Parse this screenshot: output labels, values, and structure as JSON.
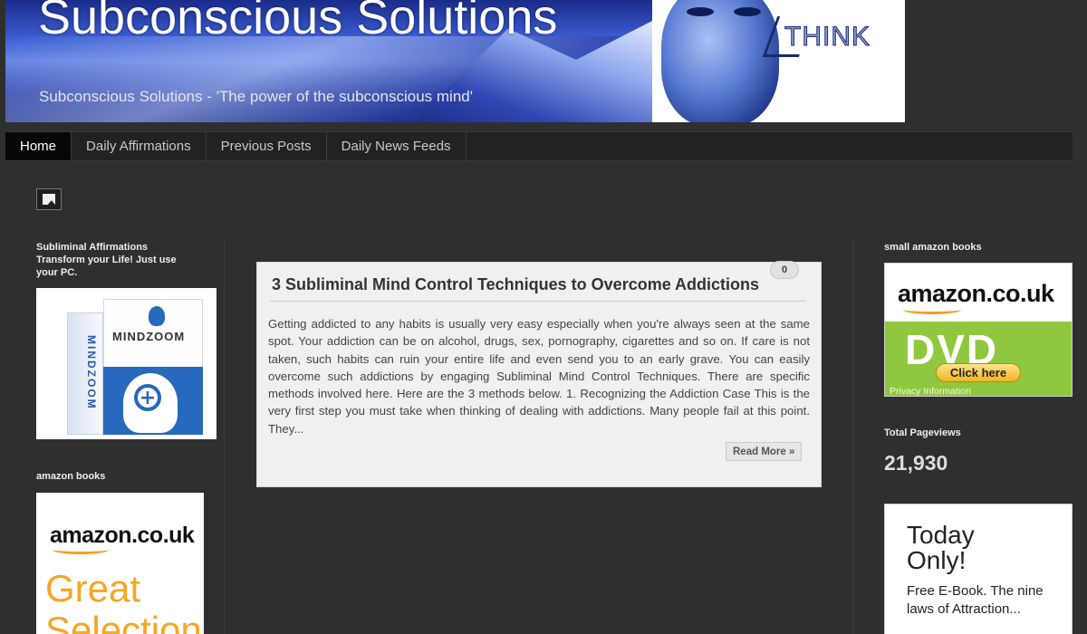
{
  "header": {
    "title": "Subconscious Solutions",
    "tagline": "Subconscious Solutions - 'The power of the subconscious mind'",
    "banner_word": "THINK"
  },
  "nav": {
    "items": [
      {
        "label": "Home",
        "active": true
      },
      {
        "label": "Daily Affirmations",
        "active": false
      },
      {
        "label": "Previous Posts",
        "active": false
      },
      {
        "label": "Daily News Feeds",
        "active": false
      }
    ]
  },
  "left_sidebar": {
    "widget1": {
      "title": "Subliminal Affirmations",
      "subtitle": "Transform your Life! Just use your PC.",
      "product": "MINDZOOM",
      "product_vertical": "MINDZOOM"
    },
    "widget2": {
      "title": "amazon books",
      "logo": "amazon.co.uk",
      "line1": "Great",
      "line2": "Selection"
    }
  },
  "post": {
    "title": "3 Subliminal Mind Control Techniques to Overcome Addictions",
    "comment_count": "0",
    "excerpt": "Getting addicted to any habits is usually very easy especially when you're always seen at the same spot. Your addiction can be on alcohol, drugs, sex, pornography, cigarettes and so on. If care is not taken, such habits can ruin your entire life and even send you to an early grave. You can easily overcome such addictions by engaging Subliminal Mind Control Techniques. There are specific methods involved here. Here are the 3 methods below. 1. Recognizing the Addiction Case This is the very first step you must take when thinking of dealing with addictions. Many people fail at this point. They...",
    "read_more": "Read More »"
  },
  "right_sidebar": {
    "widget1": {
      "title": "small amazon books",
      "logo": "amazon.co.uk",
      "dvd": "DVD",
      "button": "Click here",
      "privacy": "Privacy Information"
    },
    "pageviews": {
      "label": "Total Pageviews",
      "count": "21,930"
    },
    "promo": {
      "headline_1": "Today",
      "headline_2": "Only!",
      "text": "Free E-Book. The nine laws of Attraction..."
    }
  },
  "colors": {
    "page_bg": "#2f2f2f",
    "nav_bg": "#222222",
    "nav_active_bg": "#070707",
    "post_bg": "#f0f0f0",
    "amazon_orange": "#f6a623",
    "amazon_green": "#8fc73e",
    "mindzoom_blue": "#2669bd"
  }
}
